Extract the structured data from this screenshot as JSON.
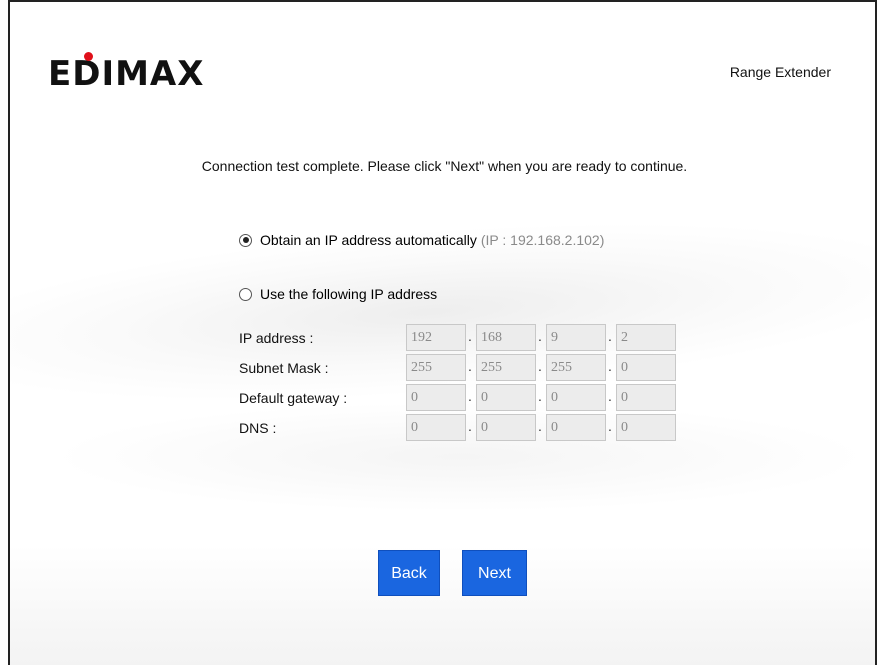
{
  "header": {
    "logo_text": "EDIMAX",
    "product_name": "Range Extender"
  },
  "message": "Connection test complete. Please click \"Next\" when you are ready to continue.",
  "options": {
    "auto": {
      "label": "Obtain an IP address automatically",
      "hint": "(IP : 192.168.2.102)",
      "selected": true
    },
    "manual": {
      "label": "Use the following IP address",
      "selected": false
    }
  },
  "ip_fields": [
    {
      "label": "IP address :",
      "octets": [
        "192",
        "168",
        "9",
        "2"
      ]
    },
    {
      "label": "Subnet Mask :",
      "octets": [
        "255",
        "255",
        "255",
        "0"
      ]
    },
    {
      "label": "Default gateway :",
      "octets": [
        "0",
        "0",
        "0",
        "0"
      ]
    },
    {
      "label": "DNS :",
      "octets": [
        "0",
        "0",
        "0",
        "0"
      ]
    }
  ],
  "buttons": {
    "back": "Back",
    "next": "Next"
  },
  "colors": {
    "button_blue": "#1a66e0",
    "logo_dot_red": "#e0101a"
  }
}
